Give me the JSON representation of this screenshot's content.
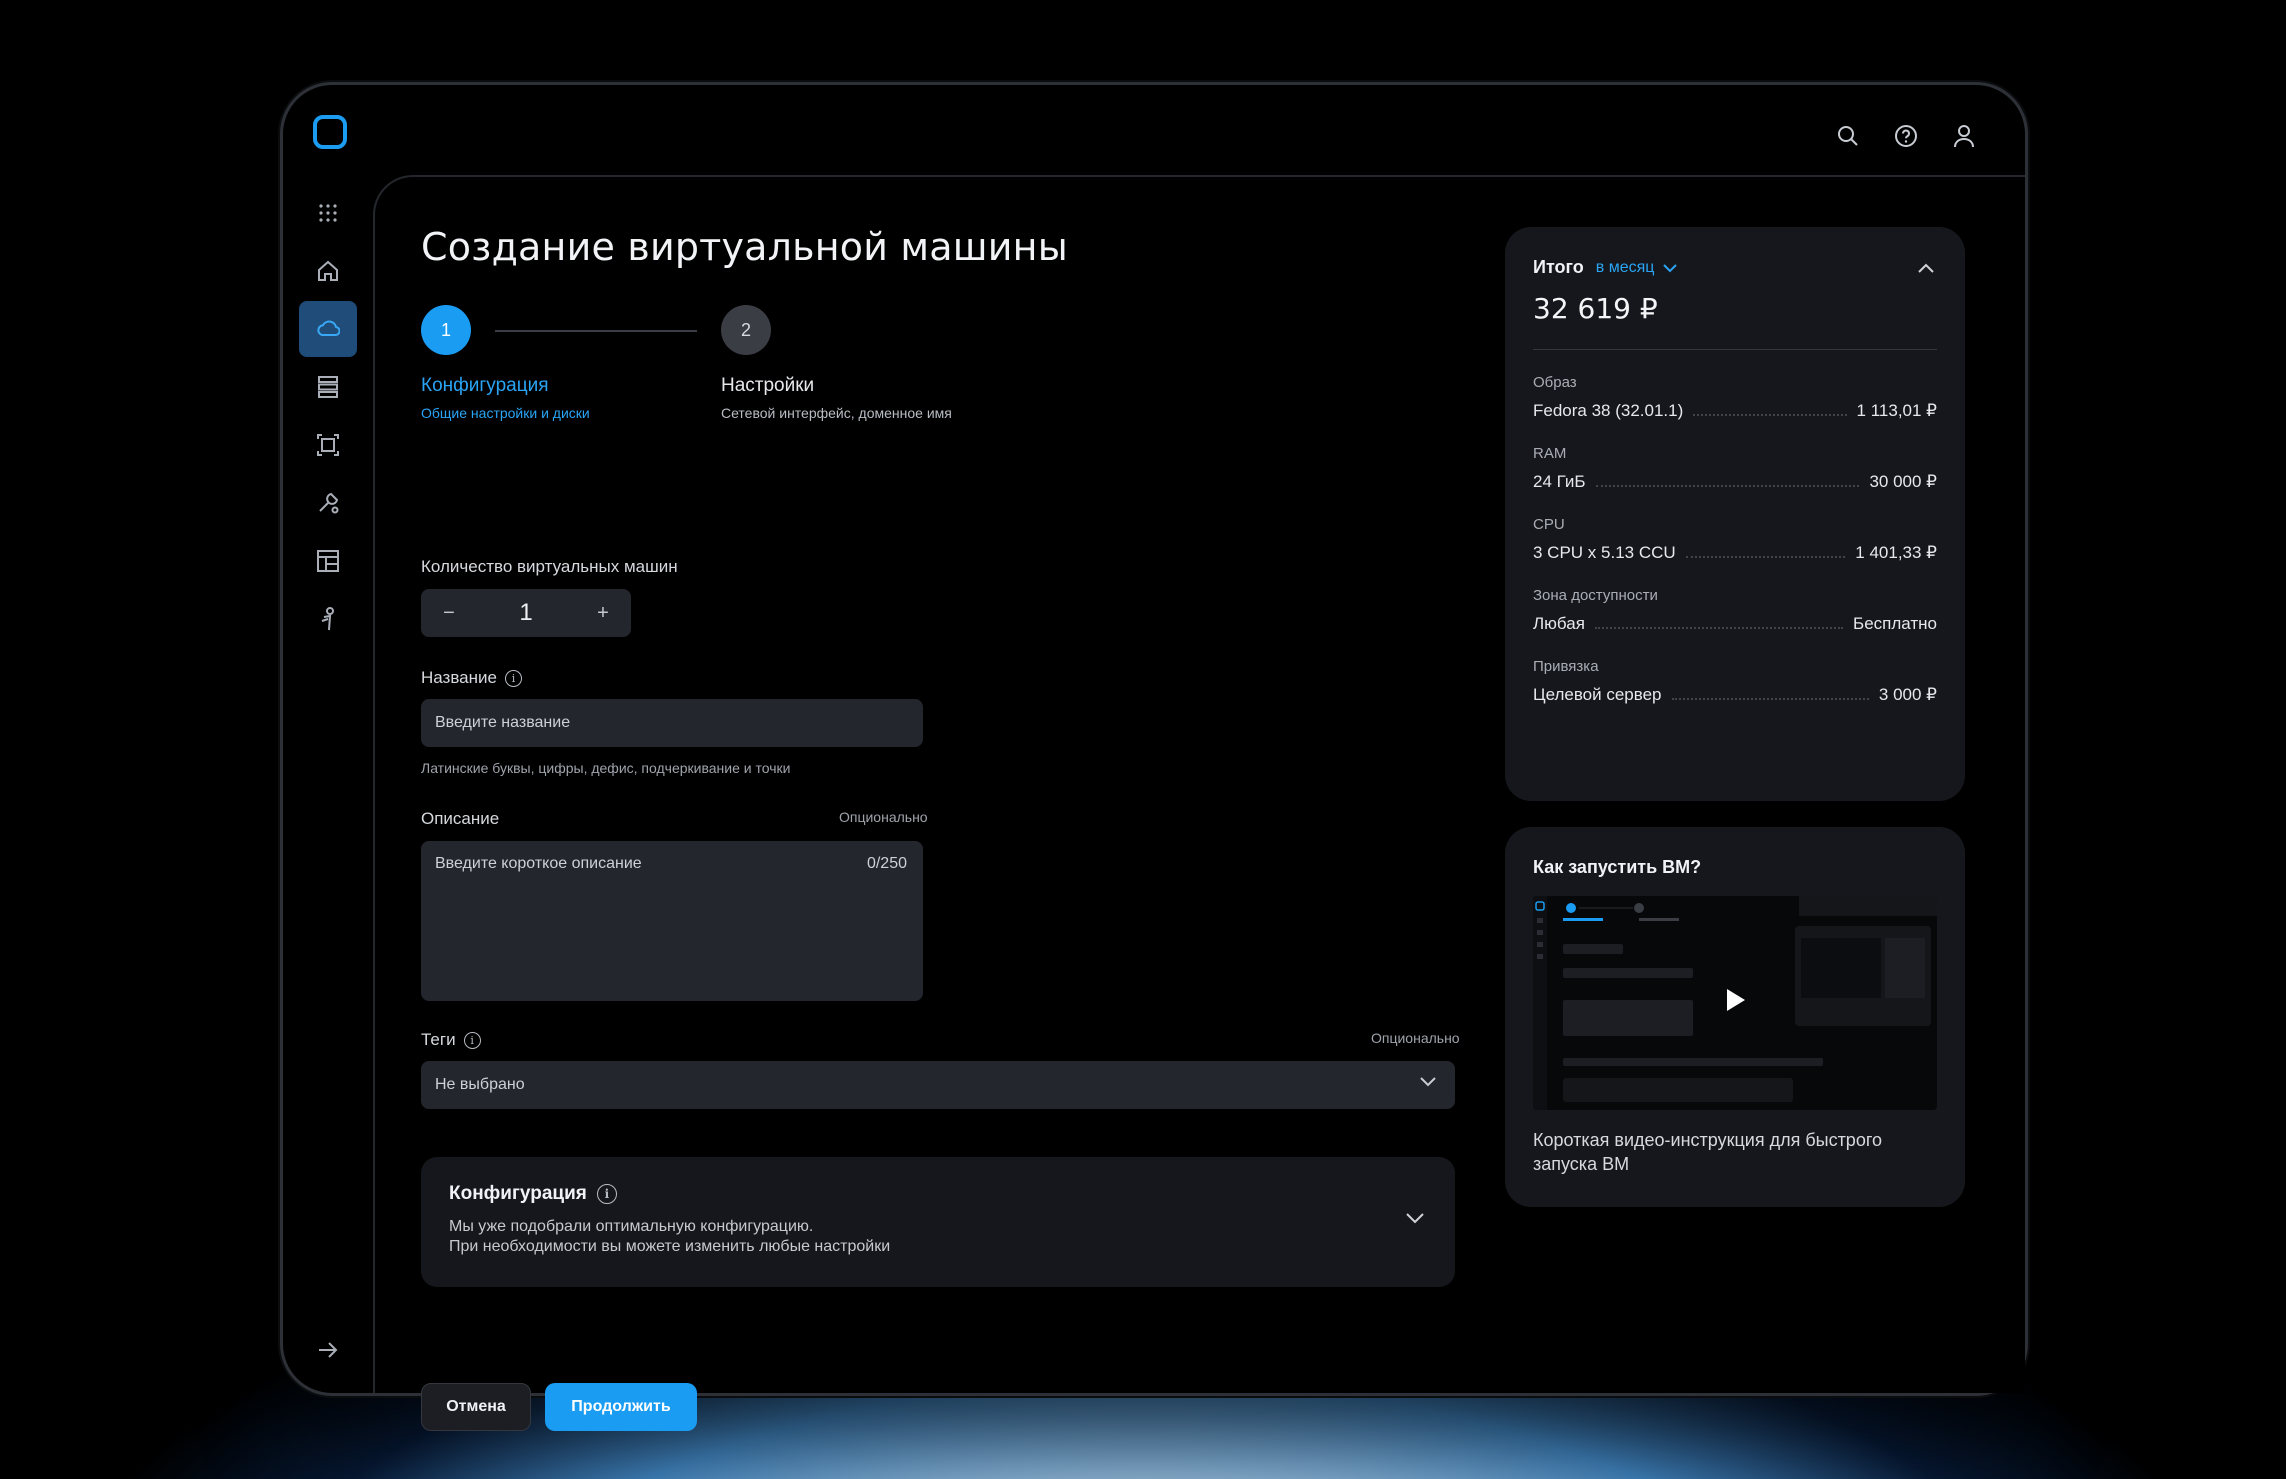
{
  "header": {
    "icons": [
      "search-icon",
      "help-icon",
      "user-icon"
    ]
  },
  "sidebar": {
    "items": [
      {
        "icon": "apps-grid-icon"
      },
      {
        "icon": "home-icon"
      },
      {
        "icon": "cloud-icon",
        "active": true
      },
      {
        "icon": "storage-icon"
      },
      {
        "icon": "frame-icon"
      },
      {
        "icon": "tools-icon"
      },
      {
        "icon": "layout-icon"
      },
      {
        "icon": "person-icon"
      }
    ],
    "bottom_icon": "arrow-right-icon"
  },
  "page": {
    "title": "Создание виртуальной машины"
  },
  "steps": [
    {
      "number": "1",
      "label": "Конфигурация",
      "sub": "Общие настройки и диски",
      "active": true
    },
    {
      "number": "2",
      "label": "Настройки",
      "sub": "Сетевой интерфейс, доменное имя",
      "active": false
    }
  ],
  "form": {
    "count_label": "Количество виртуальных машин",
    "count_minus": "−",
    "count_value": "1",
    "count_plus": "+",
    "name_label": "Название",
    "name_placeholder": "Введите название",
    "name_hint": "Латинские буквы, цифры, дефис, подчеркивание и точки",
    "desc_label": "Описание",
    "desc_optional": "Опционально",
    "desc_placeholder": "Введите короткое описание",
    "desc_counter": "0/250",
    "tags_label": "Теги",
    "tags_optional": "Опционально",
    "tags_value": "Не выбрано"
  },
  "config": {
    "title": "Конфигурация",
    "line1": "Мы уже подобрали оптимальную конфигурацию.",
    "line2": "При необходимости вы можете изменить любые настройки"
  },
  "buttons": {
    "cancel": "Отмена",
    "continue": "Продолжить"
  },
  "summary": {
    "label": "Итого",
    "period": "в месяц",
    "total": "32 619 ₽",
    "items": [
      {
        "category": "Образ",
        "name": "Fedora 38 (32.01.1)",
        "price": "1 113,01 ₽"
      },
      {
        "category": "RAM",
        "name": "24 ГиБ",
        "price": "30 000 ₽"
      },
      {
        "category": "CPU",
        "name": "3 CPU x 5.13 CCU",
        "price": "1 401,33 ₽"
      },
      {
        "category": "Зона доступности",
        "name": "Любая",
        "price": "Бесплатно"
      },
      {
        "category": "Привязка",
        "name": "Целевой сервер",
        "price": "3 000 ₽"
      }
    ]
  },
  "video": {
    "title": "Как запустить ВМ?",
    "caption_line1": "Короткая видео-инструкция для быстрого",
    "caption_line2": "запуска ВМ"
  },
  "colors": {
    "accent": "#1a9cf2",
    "card": "#16171c",
    "input": "#24262d"
  }
}
